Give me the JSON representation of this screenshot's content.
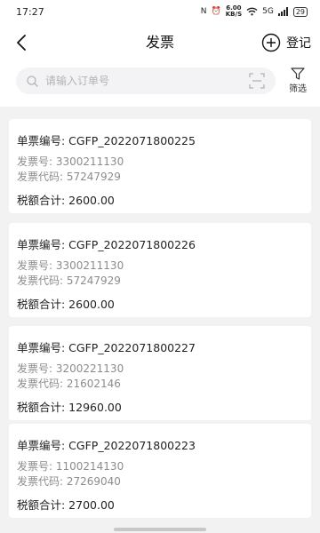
{
  "status_bar": {
    "time": "17:27",
    "net_speed_top": "6.00",
    "net_speed_unit": "KB/S",
    "signal": "5G",
    "battery": "29"
  },
  "header": {
    "back_icon": "chevron-left-icon",
    "title": "发票",
    "register_label": "登记",
    "register_icon": "plus-circle-icon"
  },
  "search": {
    "placeholder": "请输入订单号",
    "value": "",
    "scan_icon": "scan-icon",
    "filter_label": "筛选",
    "filter_icon": "funnel-icon"
  },
  "invoices": [
    {
      "number_text": "单票编号: CGFP_2022071800225",
      "invoice_no_text": "发票号: 3300211130",
      "invoice_code_text": "发票代码: 57247929",
      "tax_total_text": "税额合计: 2600.00"
    },
    {
      "number_text": "单票编号: CGFP_2022071800226",
      "invoice_no_text": "发票号: 3300211130",
      "invoice_code_text": "发票代码: 57247929",
      "tax_total_text": "税额合计: 2600.00"
    },
    {
      "number_text": "单票编号: CGFP_2022071800227",
      "invoice_no_text": "发票号: 3200221130",
      "invoice_code_text": "发票代码: 21602146",
      "tax_total_text": "税额合计: 12960.00"
    },
    {
      "number_text": "单票编号: CGFP_2022071800223",
      "invoice_no_text": "发票号: 1100214130",
      "invoice_code_text": "发票代码: 27269040",
      "tax_total_text": "税额合计: 2700.00"
    }
  ]
}
